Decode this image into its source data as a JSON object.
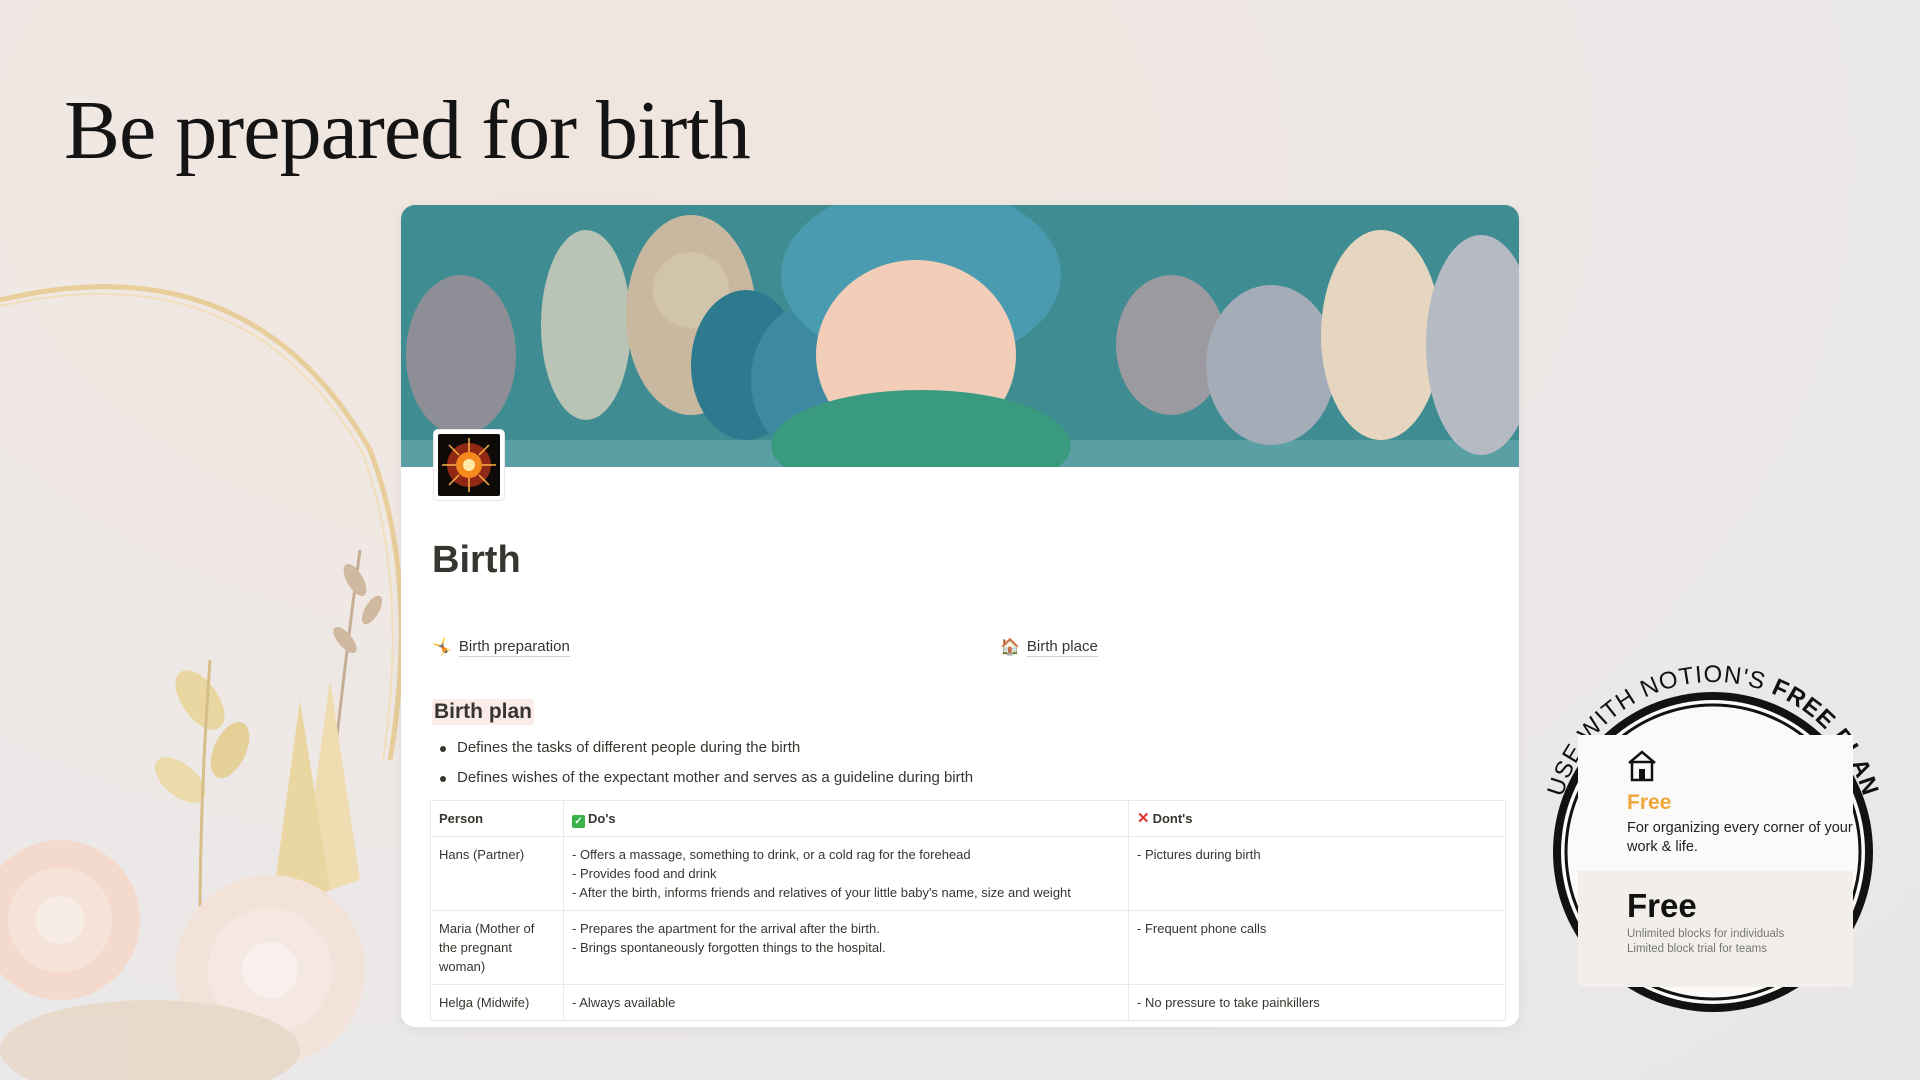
{
  "headline": "Be prepared for birth",
  "page": {
    "icon": "fireworks-icon",
    "title": "Birth",
    "links": [
      {
        "icon": "person-cartwheel-icon",
        "emoji": "🤸",
        "label": "Birth preparation"
      },
      {
        "icon": "house-icon",
        "emoji": "🏠",
        "label": "Birth place"
      }
    ],
    "section_heading": "Birth plan",
    "bullets": [
      "Defines the tasks of different people during the birth",
      "Defines wishes of the expectant mother and serves as a guideline during birth"
    ],
    "table": {
      "headers": {
        "person": "Person",
        "dos": "Do's",
        "donts": "Dont's"
      },
      "rows": [
        {
          "person": "Hans (Partner)",
          "dos": [
            "- Offers a massage, something to drink, or a cold rag for the forehead",
            "- Provides food and drink",
            "- After the birth, informs friends and relatives of your little baby's name, size and weight"
          ],
          "donts": [
            "- Pictures during birth"
          ]
        },
        {
          "person": "Maria (Mother of the pregnant woman)",
          "dos": [
            "- Prepares the apartment for the arrival after the birth.",
            "- Brings spontaneously forgotten things to the hospital."
          ],
          "donts": [
            "- Frequent phone calls"
          ]
        },
        {
          "person": "Helga (Midwife)",
          "dos": [
            "- Always available"
          ],
          "donts": [
            "- No pressure to take painkillers"
          ]
        }
      ]
    }
  },
  "badge": {
    "arc_text_regular": "USE WITH NOTION'S ",
    "arc_text_bold": "FREE PLAN",
    "icon": "home-icon",
    "plan_name": "Free",
    "plan_desc": "For organizing every corner of your work & life.",
    "plan_price": "Free",
    "plan_note_1": "Unlimited blocks for individuals",
    "plan_note_2": "Limited block trial for teams"
  },
  "colors": {
    "accent_free": "#f0a73a",
    "check_green": "#38b34a",
    "cross_red": "#e3312d",
    "heading_highlight": "#fbecea"
  }
}
